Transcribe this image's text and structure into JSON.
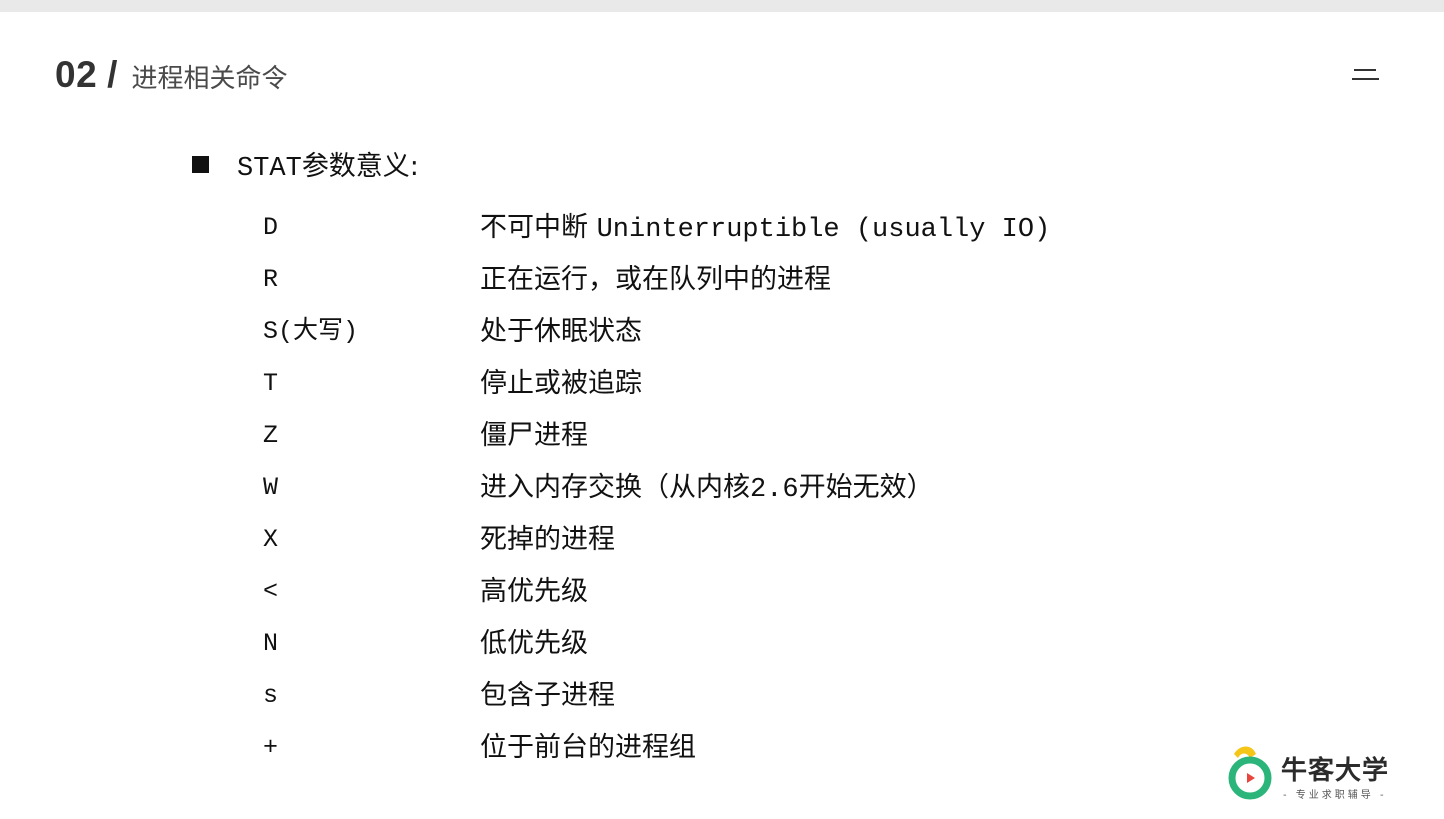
{
  "header": {
    "section_number": "02",
    "separator": "/",
    "title": "进程相关命令"
  },
  "intro": {
    "code": "STAT",
    "label": "参数意义:"
  },
  "rows": [
    {
      "code": "D",
      "desc_cn": "不可中断 ",
      "desc_mono": "Uninterruptible (usually IO)",
      "desc_tail": ""
    },
    {
      "code": "R",
      "desc_cn": "正在运行，或在队列中的进程",
      "desc_mono": "",
      "desc_tail": ""
    },
    {
      "code": "S(大写)",
      "desc_cn": "处于休眠状态",
      "desc_mono": "",
      "desc_tail": ""
    },
    {
      "code": "T",
      "desc_cn": "停止或被追踪",
      "desc_mono": "",
      "desc_tail": ""
    },
    {
      "code": "Z",
      "desc_cn": "僵尸进程",
      "desc_mono": "",
      "desc_tail": ""
    },
    {
      "code": "W",
      "desc_cn": "进入内存交换（从内核",
      "desc_mono": "2.6",
      "desc_tail": "开始无效）"
    },
    {
      "code": "X",
      "desc_cn": "死掉的进程",
      "desc_mono": "",
      "desc_tail": ""
    },
    {
      "code": "<",
      "desc_cn": "高优先级",
      "desc_mono": "",
      "desc_tail": ""
    },
    {
      "code": "N",
      "desc_cn": "低优先级",
      "desc_mono": "",
      "desc_tail": ""
    },
    {
      "code": "s",
      "desc_cn": "包含子进程",
      "desc_mono": "",
      "desc_tail": ""
    },
    {
      "code": "+",
      "desc_cn": "位于前台的进程组",
      "desc_mono": "",
      "desc_tail": ""
    }
  ],
  "logo": {
    "name": "牛客大学",
    "tagline": "- 专业求职辅导 -",
    "icon": "niuke-logo-icon",
    "colors": {
      "yellow": "#f5c518",
      "green": "#2bb57a",
      "red": "#e8453c"
    }
  },
  "menu": {
    "icon": "menu-icon"
  }
}
